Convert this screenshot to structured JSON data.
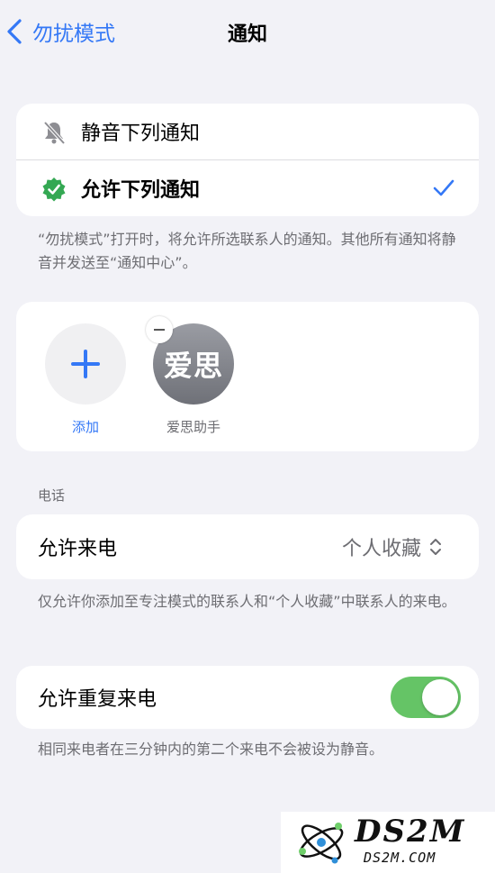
{
  "nav": {
    "back_label": "勿扰模式",
    "title": "通知"
  },
  "notify_mode": {
    "silence_label": "静音下列通知",
    "allow_label": "允许下列通知",
    "selected": "allow",
    "footer": "“勿扰模式”打开时，将允许所选联系人的通知。其他所有通知将静音并发送至“通知中心”。"
  },
  "people": {
    "add_label": "添加",
    "contacts": [
      {
        "initials": "爱思",
        "name": "爱思助手"
      }
    ]
  },
  "calls": {
    "section_header": "电话",
    "allow_calls_label": "允许来电",
    "allow_calls_value": "个人收藏",
    "allow_calls_footer": "仅允许你添加至专注模式的联系人和“个人收藏”中联系人的来电。",
    "repeat_calls_label": "允许重复来电",
    "repeat_calls_on": true,
    "repeat_calls_footer": "相同来电者在三分钟内的第二个来电不会被设为静音。"
  },
  "watermark": {
    "main": "DS2M",
    "sub": "DS2M.COM"
  },
  "colors": {
    "accent": "#3478f6",
    "toggle_on": "#65c466",
    "check_badge": "#34a853"
  }
}
